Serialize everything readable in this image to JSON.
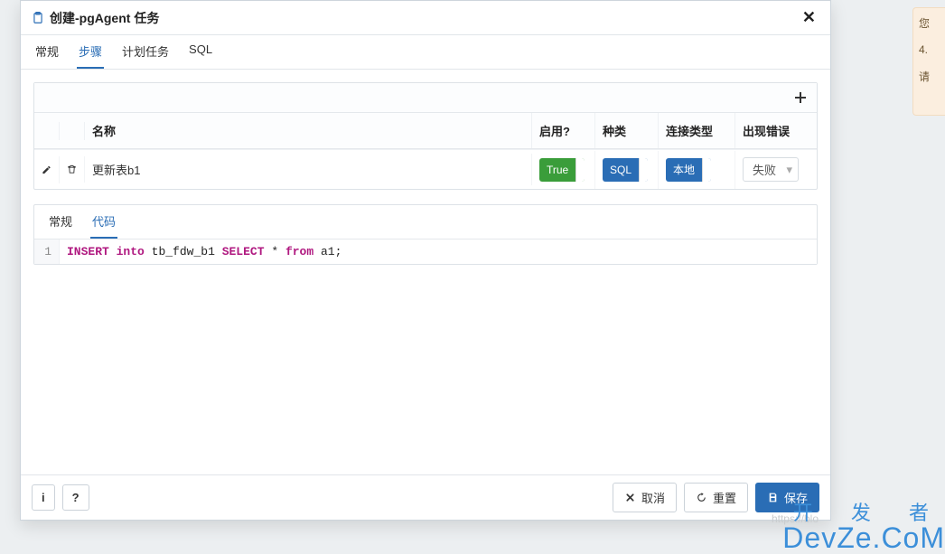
{
  "dialog": {
    "title": "创建-pgAgent 任务",
    "tabs": [
      {
        "label": "常规",
        "active": false
      },
      {
        "label": "步骤",
        "active": true
      },
      {
        "label": "计划任务",
        "active": false
      },
      {
        "label": "SQL",
        "active": false
      }
    ]
  },
  "grid": {
    "columns": {
      "name": "名称",
      "enabled": "启用?",
      "kind": "种类",
      "conn": "连接类型",
      "onerror": "出现错误"
    },
    "rows": [
      {
        "name": "更新表b1",
        "enabled_label": "True",
        "kind_label": "SQL",
        "conn_label": "本地",
        "onerror_label": "失败"
      }
    ]
  },
  "sub": {
    "tabs": [
      {
        "label": "常规",
        "active": false
      },
      {
        "label": "代码",
        "active": true
      }
    ],
    "code": {
      "line_no": "1",
      "tokens": {
        "k1": "INSERT",
        "k2": "into",
        "t1": "tb_fdw_b1",
        "k3": "SELECT",
        "t2": "*",
        "k4": "from",
        "t3": "a1;"
      }
    }
  },
  "footer": {
    "info": "i",
    "help": "?",
    "cancel": "取消",
    "reset": "重置",
    "save": "保存"
  },
  "side": {
    "a": "您",
    "b": "4.",
    "c": "请"
  },
  "watermark": {
    "url": "https://blo",
    "line1": "开 发 者",
    "line2": "DevZe.CoM"
  }
}
